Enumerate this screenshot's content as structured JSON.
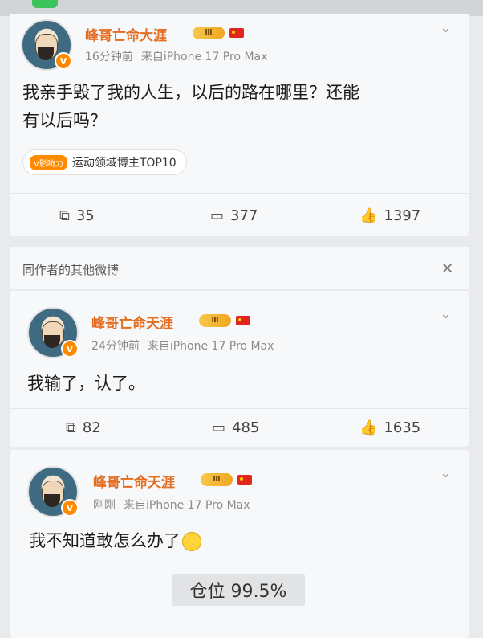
{
  "colors": {
    "username": "#e46d1f",
    "vip_gold": "#f0a623",
    "flag_red": "#e0261d",
    "meta_gray": "#8a8a8a"
  },
  "post1": {
    "username": "峰哥亡命大涯",
    "vip_level": "Ⅲ",
    "time": "16分钟前",
    "source": "来自iPhone 17 Pro Max",
    "content_line1": "我亲手毁了我的人生，以后的路在哪里？还能",
    "content_line2": "有以后吗？",
    "tag_badge": "V影响力",
    "tag_label": "运动领域博主TOP10",
    "reposts": "35",
    "comments": "377",
    "likes": "1397",
    "icons": [
      "repost-icon",
      "comment-icon",
      "like-icon"
    ]
  },
  "section": {
    "title": "同作者的其他微博",
    "close_icon": "×"
  },
  "post2": {
    "username": "峰哥亡命天涯",
    "vip_level": "Ⅲ",
    "time": "24分钟前",
    "source": "来自iPhone 17 Pro Max",
    "content": "我输了，认了。",
    "reposts": "82",
    "comments": "485",
    "likes": "1635"
  },
  "post3": {
    "username": "峰哥亡命天涯",
    "vip_level": "Ⅲ",
    "time": "刚刚",
    "source": "来自iPhone 17 Pro Max",
    "content": "我不知道敢怎么办了",
    "position_label": "仓位 99.5%"
  }
}
